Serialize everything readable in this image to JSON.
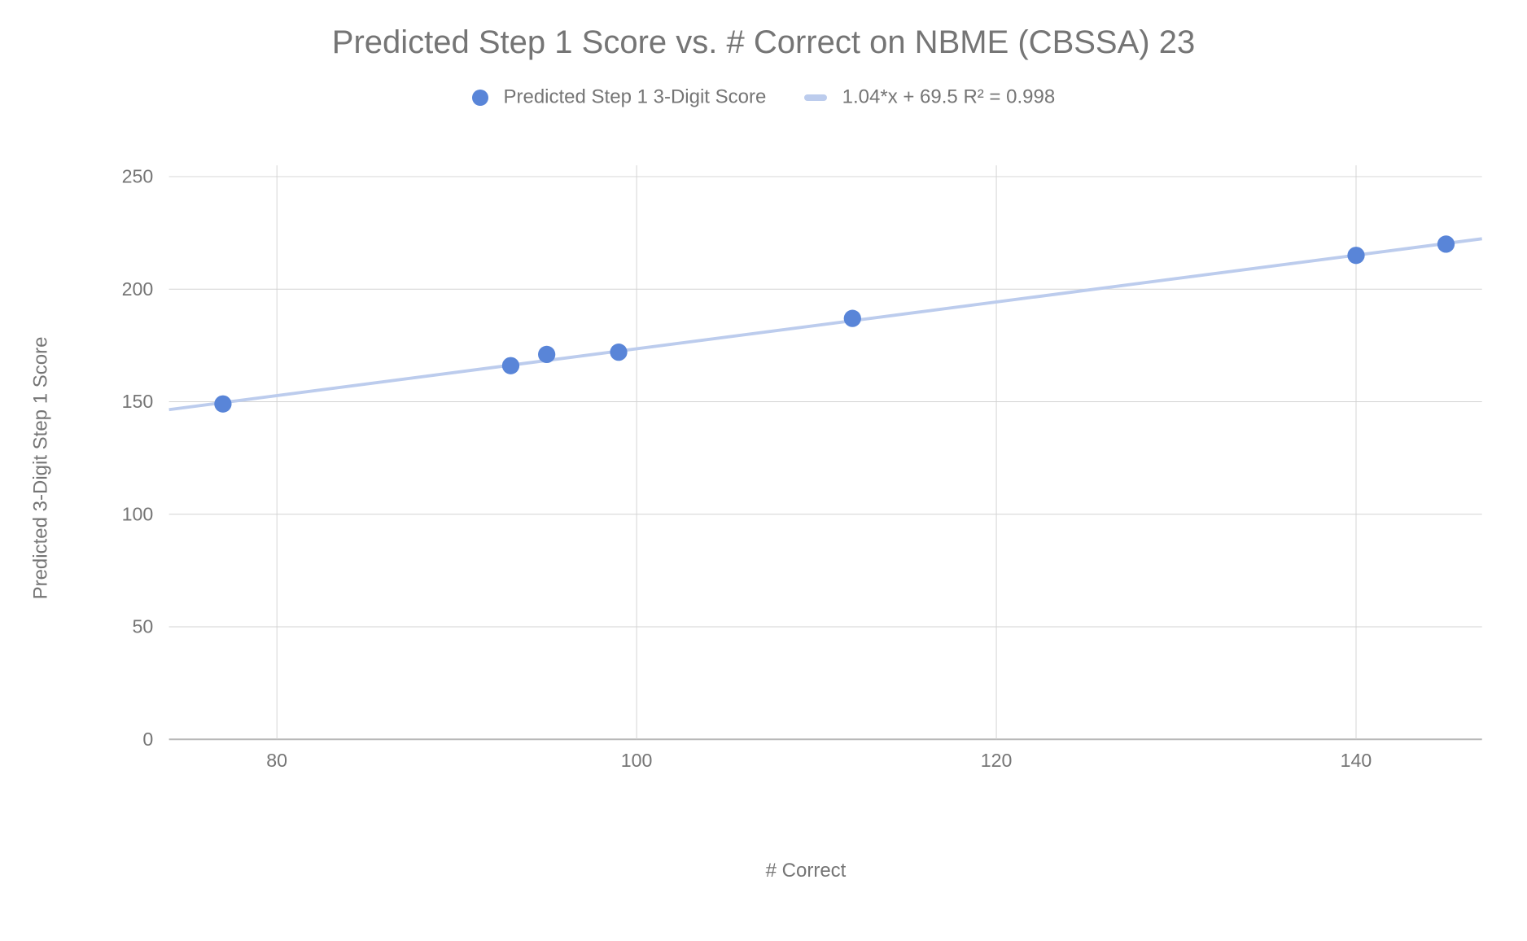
{
  "chart_data": {
    "type": "scatter",
    "title": "Predicted Step 1 Score vs. # Correct on NBME (CBSSA) 23",
    "xlabel": "# Correct",
    "ylabel": "Predicted 3-Digit Step 1 Score",
    "xlim": [
      74,
      147
    ],
    "ylim": [
      0,
      255
    ],
    "xticks": [
      80,
      100,
      120,
      140
    ],
    "yticks": [
      0,
      50,
      100,
      150,
      200,
      250
    ],
    "series": [
      {
        "name": "Predicted Step 1 3-Digit Score",
        "color": "#5985d8",
        "points": [
          {
            "x": 77,
            "y": 149
          },
          {
            "x": 93,
            "y": 166
          },
          {
            "x": 95,
            "y": 171
          },
          {
            "x": 99,
            "y": 172
          },
          {
            "x": 112,
            "y": 187
          },
          {
            "x": 140,
            "y": 215
          },
          {
            "x": 145,
            "y": 220
          }
        ]
      }
    ],
    "trendline": {
      "label": "1.04*x + 69.5 R² = 0.998",
      "slope": 1.04,
      "intercept": 69.5,
      "r2": 0.998,
      "color": "#bccced"
    },
    "legend": [
      {
        "kind": "dot",
        "label": "Predicted Step 1 3-Digit Score",
        "color": "#5985d8"
      },
      {
        "kind": "line",
        "label": "1.04*x + 69.5 R² = 0.998",
        "color": "#bccced"
      }
    ]
  }
}
